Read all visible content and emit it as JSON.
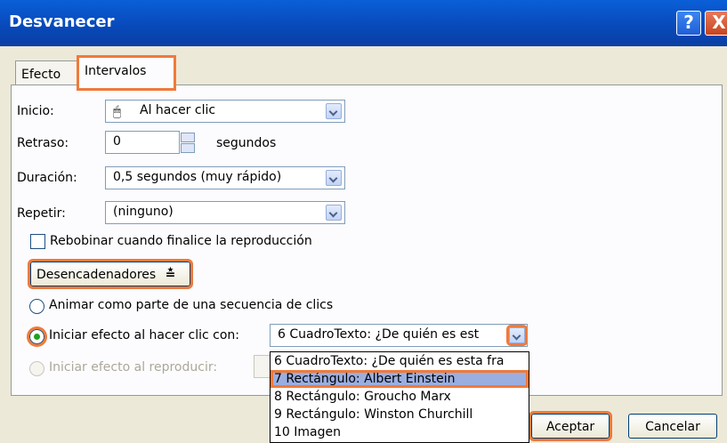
{
  "window": {
    "title": "Desvanecer",
    "help_glyph": "?",
    "close_glyph": "X"
  },
  "tabs": [
    {
      "label": "Efecto",
      "active": false
    },
    {
      "label": "Intervalos",
      "active": true
    }
  ],
  "fields": {
    "inicio": {
      "label": "Inicio:",
      "value": "Al hacer clic",
      "icon": "mouse-click-icon"
    },
    "retraso": {
      "label": "Retraso:",
      "value": "0",
      "unit": "segundos"
    },
    "duracion": {
      "label": "Duración:",
      "value": "0,5 segundos (muy rápido)"
    },
    "repetir": {
      "label": "Repetir:",
      "value": "(ninguno)"
    }
  },
  "rebobinar": {
    "label": "Rebobinar cuando finalice la reproducción",
    "checked": false
  },
  "triggers_button": {
    "label": "Desencadenadores",
    "glyph": "≛"
  },
  "radios": {
    "secuencia": {
      "label": "Animar como parte de una secuencia de clics",
      "selected": false
    },
    "clic": {
      "label": "Iniciar efecto al hacer clic con:",
      "selected": true,
      "value": "6 CuadroTexto: ¿De quién es est"
    },
    "reproducir": {
      "label": "Iniciar efecto al reproducir:",
      "selected": false,
      "enabled": false
    }
  },
  "dropdown_options": [
    "6 CuadroTexto: ¿De quién es esta fra",
    "7 Rectángulo: Albert Einstein",
    "8 Rectángulo: Groucho Marx",
    "9 Rectángulo: Winston Churchill",
    "10 Imagen"
  ],
  "selected_option_index": 1,
  "buttons": {
    "ok": "Aceptar",
    "cancel": "Cancelar"
  },
  "colors": {
    "highlight": "#f07a3a",
    "titlebar": "#0a5fd8"
  }
}
